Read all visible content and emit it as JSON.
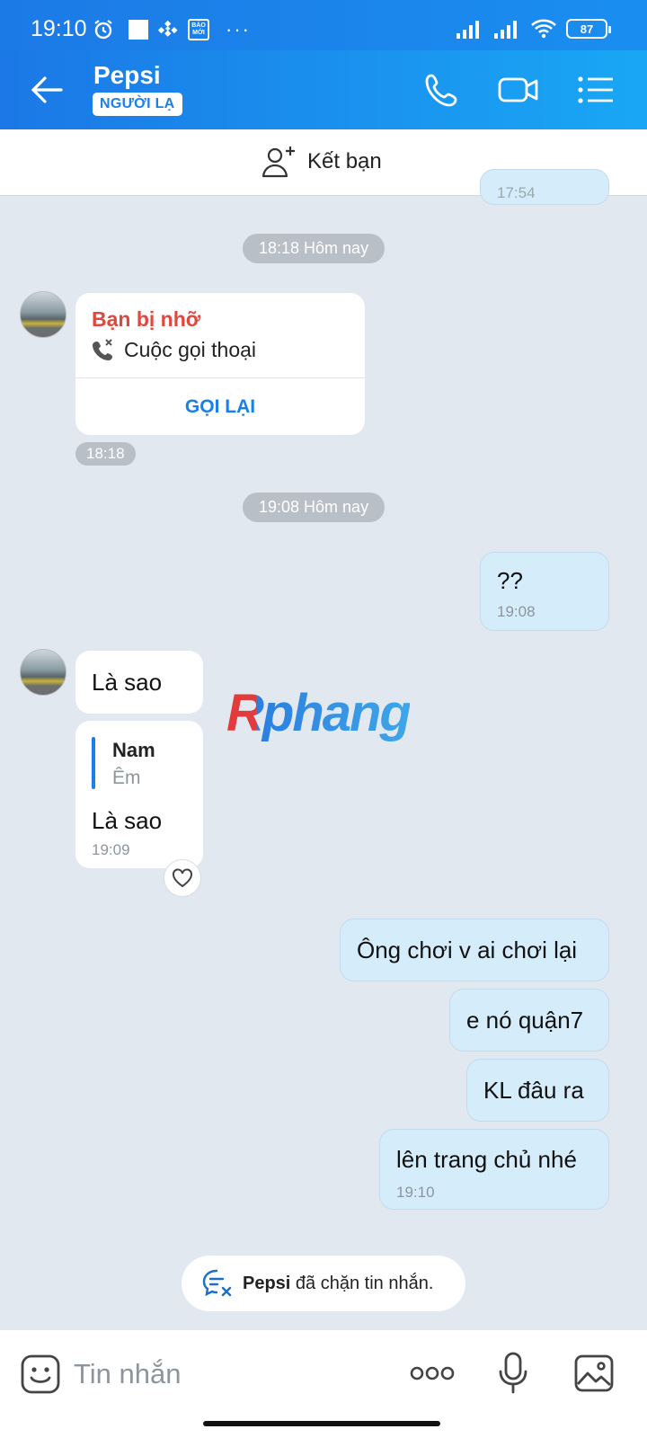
{
  "status": {
    "time": "19:10",
    "battery": "87",
    "news_badge": "BÁO MỚI"
  },
  "header": {
    "title": "Pepsi",
    "badge": "NGƯỜI LẠ"
  },
  "addfriend": {
    "label": "Kết bạn"
  },
  "chat": {
    "partial_time": "17:54",
    "date1": "18:18 Hôm nay",
    "missed": {
      "title": "Bạn bị nhỡ",
      "type": "Cuộc gọi thoại",
      "action": "GỌI LẠI",
      "time": "18:18"
    },
    "date2": "19:08 Hôm nay",
    "out1": {
      "text": "??",
      "time": "19:08"
    },
    "in1": {
      "text": "Là sao"
    },
    "in2": {
      "quote_name": "Nam",
      "quote_text": "Êm",
      "text": "Là sao",
      "time": "19:09"
    },
    "out2": {
      "text": "Ông chơi v ai chơi lại"
    },
    "out3": {
      "text": "e nó quận7"
    },
    "out4": {
      "text": "KL đâu ra"
    },
    "out5": {
      "text": "lên trang chủ nhé",
      "time": "19:10"
    },
    "blocked": {
      "name": "Pepsi",
      "text": "đã chặn tin nhắn."
    }
  },
  "watermark": "Rphang",
  "input": {
    "placeholder": "Tin nhắn"
  },
  "colors": {
    "accent": "#1b7fe9",
    "missed": "#e0483f",
    "out_bubble": "#d5ecfb"
  }
}
